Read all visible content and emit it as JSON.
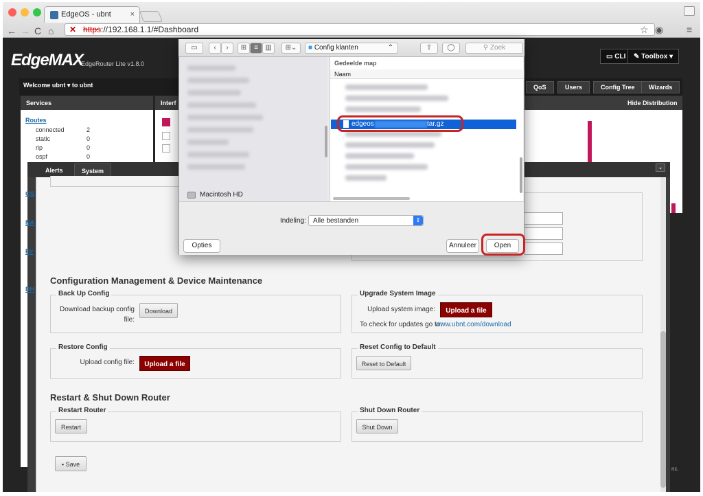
{
  "browser": {
    "tab_title": "EdgeOS - ubnt",
    "tab_close": "×",
    "url_scheme": "https",
    "url_rest": "://192.168.1.1/#Dashboard"
  },
  "header": {
    "logo": "EdgeMAX",
    "product": "EdgeRouter Lite v1.8.0",
    "cli_label": "CLI",
    "toolbox_label": "Toolbox ▾",
    "welcome": "Welcome ubnt  ▾      to ubnt",
    "tabs": [
      "QoS",
      "Users",
      "Config Tree",
      "Wizards"
    ]
  },
  "services": {
    "title": "Services",
    "routes_label": "Routes",
    "routes": [
      {
        "name": "connected",
        "count": "2"
      },
      {
        "name": "static",
        "count": "0"
      },
      {
        "name": "rip",
        "count": "0"
      },
      {
        "name": "ospf",
        "count": "0"
      }
    ],
    "side_links": [
      "OS",
      "NA",
      "Fir",
      "DH"
    ]
  },
  "interfaces": {
    "title": "Interf",
    "hide_distribution": "Hide Distribution"
  },
  "system_panel": {
    "tabs": [
      "Alerts",
      "System"
    ],
    "config_section": "Configuration Management & Device Maintenance",
    "backup": {
      "legend": "Back Up Config",
      "label": "Download backup config file:",
      "button": "Download"
    },
    "upgrade": {
      "legend": "Upgrade System Image",
      "label": "Upload system image:",
      "button": "Upload a file",
      "check_text": "To check for updates go to:",
      "check_link": "www.ubnt.com/download"
    },
    "restore": {
      "legend": "Restore Config",
      "label": "Upload config file:",
      "button": "Upload a file"
    },
    "reset": {
      "legend": "Reset Config to Default",
      "button": "Reset to Default"
    },
    "restart_section": "Restart & Shut Down Router",
    "restart": {
      "legend": "Restart Router",
      "button": "Restart"
    },
    "shutdown": {
      "legend": "Shut Down Router",
      "button": "Shut Down"
    },
    "save_button": "Save",
    "footer_fragment": "nc."
  },
  "file_dialog": {
    "location": "Config klanten",
    "search_placeholder": "Zoek",
    "shared_folder": "Gedeelde map",
    "column_name": "Naam",
    "selected_file_prefix": "edgeos",
    "selected_file_suffix": "tar.gz",
    "sidebar_volume": "Macintosh HD",
    "format_label": "Indeling:",
    "format_value": "Alle bestanden",
    "options_button": "Opties",
    "cancel_button": "Annuleer",
    "open_button": "Open"
  },
  "colors": {
    "accent_red": "#8b0000",
    "highlight_ring": "#c82424",
    "selection_blue": "#0f63d6",
    "chart_bar": "#c2185b"
  }
}
